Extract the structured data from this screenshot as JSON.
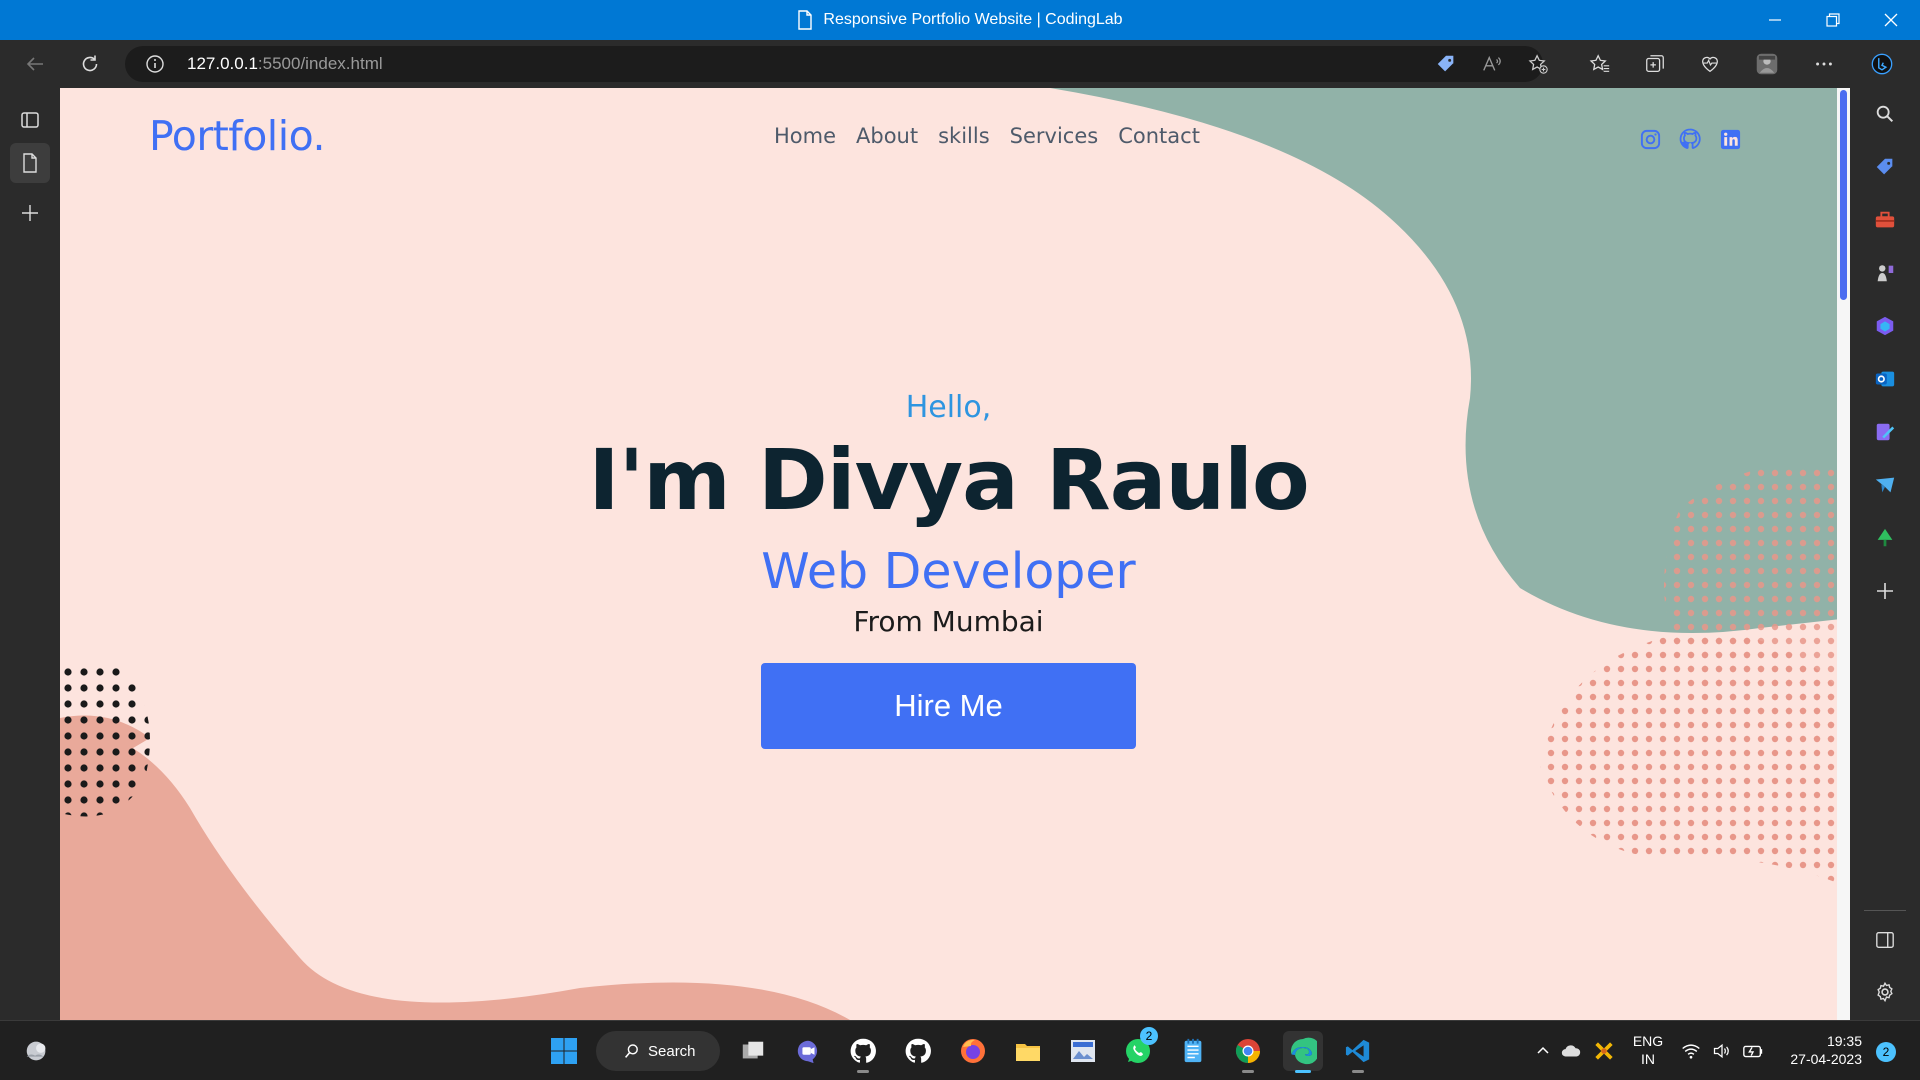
{
  "window": {
    "title": "Responsive Portfolio Website | CodingLab"
  },
  "browser": {
    "url_host": "127.0.0.1",
    "url_rest": ":5500/index.html"
  },
  "page": {
    "logo": "Portfolio.",
    "nav": [
      "Home",
      "About",
      "skills",
      "Services",
      "Contact"
    ],
    "social": [
      "instagram-icon",
      "github-icon",
      "linkedin-icon"
    ],
    "hero": {
      "greeting": "Hello,",
      "name": "I'm Divya Raulo",
      "role": "Web Developer",
      "location": "From Mumbai",
      "cta": "Hire Me"
    },
    "colors": {
      "accent": "#4070f4",
      "background": "#fde4de",
      "teal_blob": "#91b2a8",
      "salmon_blob": "#e9a99a"
    }
  },
  "taskbar": {
    "search_label": "Search",
    "whatsapp_badge": "2",
    "language_line1": "ENG",
    "language_line2": "IN",
    "time": "19:35",
    "date": "27-04-2023",
    "notification_count": "2"
  }
}
